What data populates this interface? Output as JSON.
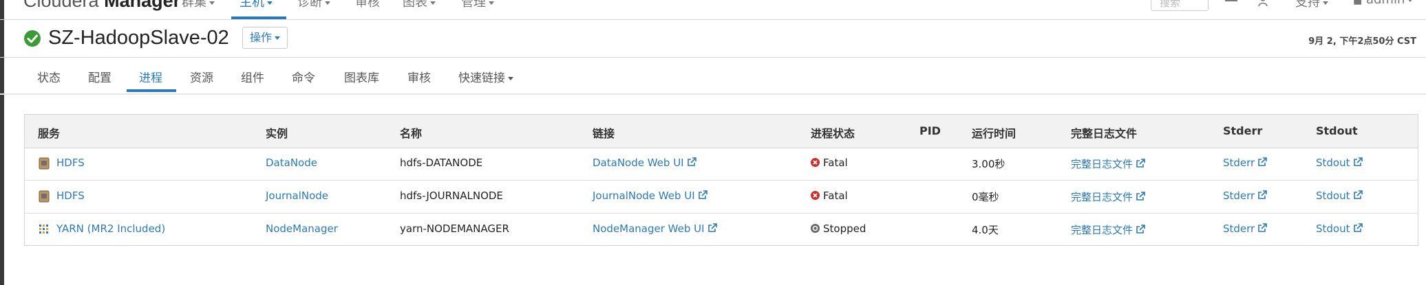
{
  "navbar": {
    "brand_light": "Cloudera ",
    "brand_bold": "Manager",
    "items": [
      {
        "label": "群集"
      },
      {
        "label": "主机"
      },
      {
        "label": "诊断"
      },
      {
        "label": "审核"
      },
      {
        "label": "图表"
      },
      {
        "label": "管理"
      }
    ],
    "search_placeholder": "搜索",
    "support_label": "支持",
    "user_label": "admin",
    "accent_color": "#2a7ab8"
  },
  "host": {
    "name": "SZ-HadoopSlave-02",
    "actions_label": "操作",
    "timestamp": "9月 2, 下午2点50分 CST",
    "status_color": "#3c9a37"
  },
  "tabs": [
    {
      "label": "状态"
    },
    {
      "label": "配置"
    },
    {
      "label": "进程"
    },
    {
      "label": "资源"
    },
    {
      "label": "组件"
    },
    {
      "label": "命令"
    },
    {
      "label": "图表库"
    },
    {
      "label": "审核"
    },
    {
      "label": "快速链接"
    }
  ],
  "table": {
    "headers": {
      "service": "服务",
      "instance": "实例",
      "name": "名称",
      "link": "链接",
      "status": "进程状态",
      "pid": "PID",
      "uptime": "运行时间",
      "full_log": "完整日志文件",
      "stderr": "Stderr",
      "stdout": "Stdout"
    },
    "rows": [
      {
        "service": "HDFS",
        "service_icon": "hdfs-icon",
        "instance": "DataNode",
        "name": "hdfs-DATANODE",
        "link": "DataNode Web UI",
        "status": "Fatal",
        "pid": "",
        "uptime": "3.00秒",
        "full_log": "完整日志文件",
        "stderr": "Stderr",
        "stdout": "Stdout"
      },
      {
        "service": "HDFS",
        "service_icon": "hdfs-icon",
        "instance": "JournalNode",
        "name": "hdfs-JOURNALNODE",
        "link": "JournalNode Web UI",
        "status": "Fatal",
        "pid": "",
        "uptime": "0毫秒",
        "full_log": "完整日志文件",
        "stderr": "Stderr",
        "stdout": "Stdout"
      },
      {
        "service": "YARN (MR2 Included)",
        "service_icon": "yarn-icon",
        "instance": "NodeManager",
        "name": "yarn-NODEMANAGER",
        "link": "NodeManager Web UI",
        "status": "Stopped",
        "pid": "",
        "uptime": "4.0天",
        "full_log": "完整日志文件",
        "stderr": "Stderr",
        "stdout": "Stdout"
      }
    ],
    "fatal_color": "#c9302c",
    "stopped_color": "#666666"
  }
}
